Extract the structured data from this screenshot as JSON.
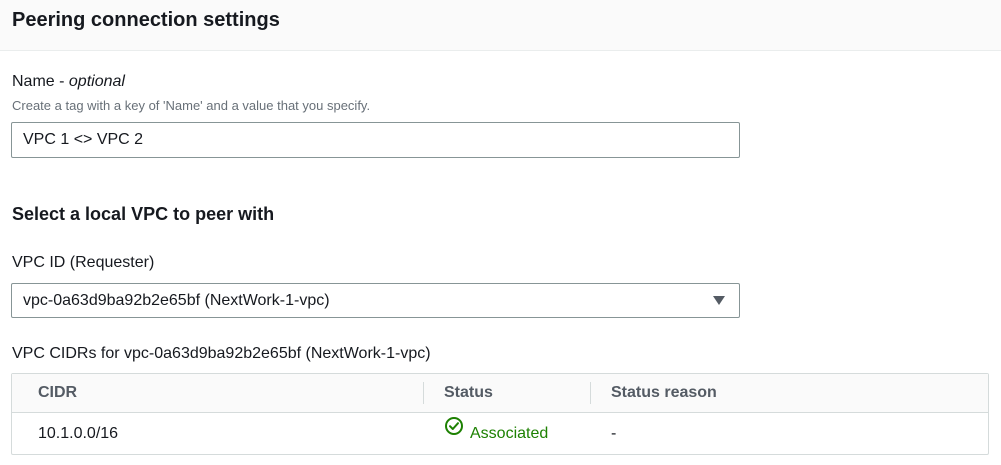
{
  "header": {
    "title": "Peering connection settings"
  },
  "name_field": {
    "label": "Name - ",
    "label_optional": "optional",
    "description": "Create a tag with a key of 'Name' and a value that you specify.",
    "value": "VPC 1 <> VPC 2"
  },
  "local_vpc": {
    "section_title": "Select a local VPC to peer with",
    "vpc_id_label": "VPC ID (Requester)",
    "vpc_id_value": "vpc-0a63d9ba92b2e65bf (NextWork-1-vpc)",
    "cidrs_label": "VPC CIDRs for vpc-0a63d9ba92b2e65bf (NextWork-1-vpc)"
  },
  "cidr_table": {
    "columns": [
      "CIDR",
      "Status",
      "Status reason"
    ],
    "rows": [
      {
        "cidr": "10.1.0.0/16",
        "status": "Associated",
        "status_reason": "-"
      }
    ]
  },
  "colors": {
    "status_success": "#1d8102",
    "border": "#879596"
  },
  "icons": {
    "status": "check-circle-icon",
    "select": "caret-down-icon"
  }
}
